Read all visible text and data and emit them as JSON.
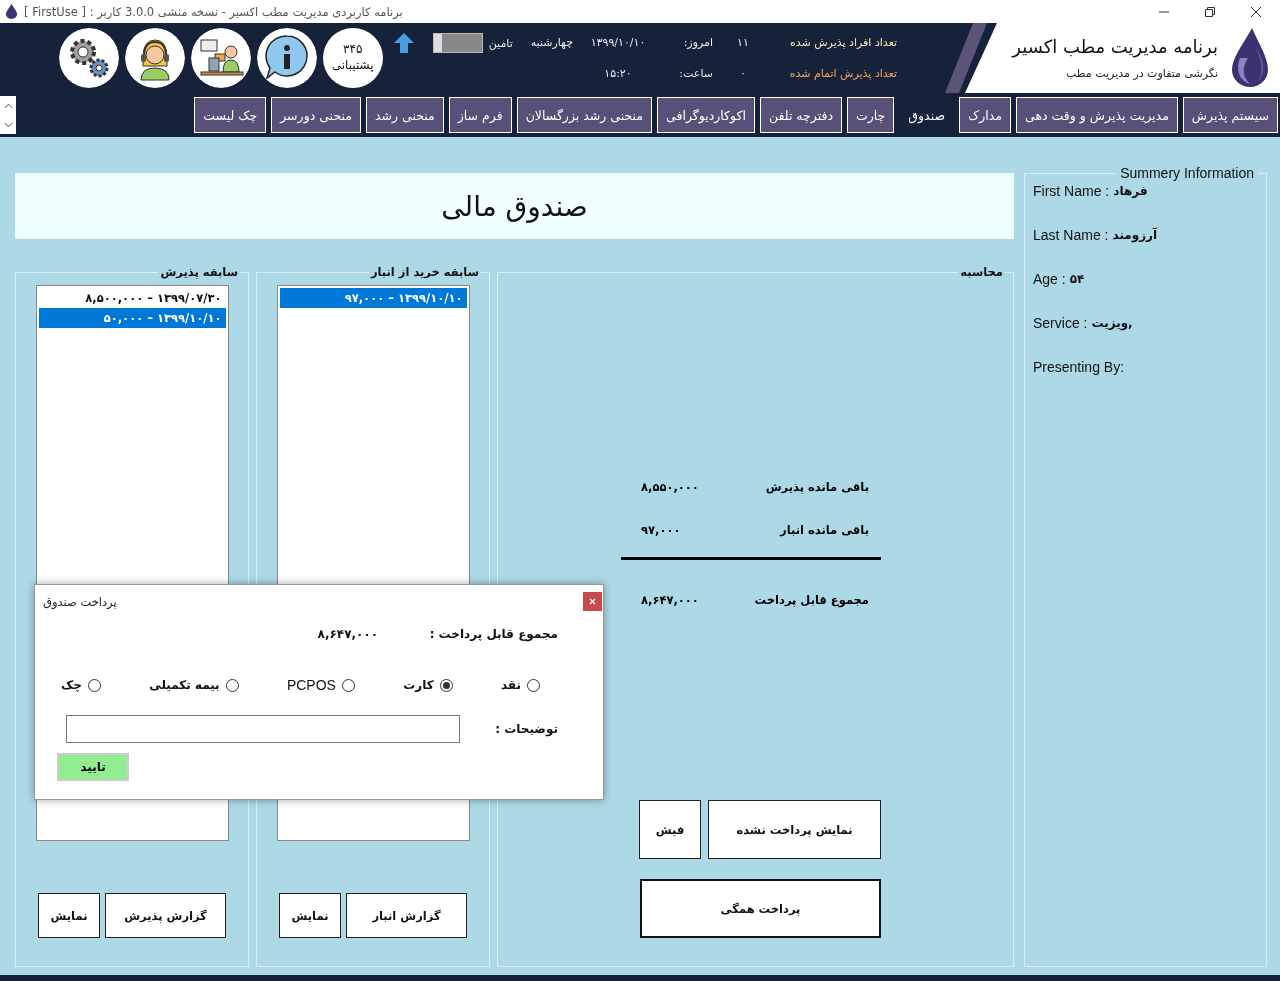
{
  "window": {
    "title": "برنامه کاربردی مدیریت مطب اکسیر - نسخه منشی 3.0.0 کاربر : [ FirstUse ]"
  },
  "header": {
    "app_title": "برنامه مدیریت مطب اکسیر",
    "tagline": "نگرشی متفاوت در مدیریت مطب",
    "stats": [
      {
        "label": "تعداد افراد پذیرش شده",
        "value": "۱۱",
        "color": "#f3e9b5"
      },
      {
        "label": "تعداد پذیرش اتمام شده",
        "value": "۰",
        "color": "#f4a460"
      }
    ],
    "date_label": "امروز:",
    "date": "۱۳۹۹/۱۰/۱۰",
    "weekday": "چهارشنبه",
    "time_label": "ساعت:",
    "time": "۱۵:۲۰",
    "toggle": {
      "label": "تامین",
      "on": false
    },
    "support": {
      "number": "۳۴۵",
      "label": "پشتیبانی"
    }
  },
  "tabs": [
    {
      "label": "سیستم پذیرش",
      "selected": false
    },
    {
      "label": "مدیریت پذیرش و وقت دهی",
      "selected": false
    },
    {
      "label": "مدارک",
      "selected": false
    },
    {
      "label": "صندوق",
      "selected": true
    },
    {
      "label": "چارت",
      "selected": false
    },
    {
      "label": "دفترچه تلفن",
      "selected": false
    },
    {
      "label": "اکوکاردیوگرافی",
      "selected": false
    },
    {
      "label": "منحنی رشد بزرگسالان",
      "selected": false
    },
    {
      "label": "فرم ساز",
      "selected": false
    },
    {
      "label": "منحنی رشد",
      "selected": false
    },
    {
      "label": "منحنی دورسر",
      "selected": false
    },
    {
      "label": "چک لیست",
      "selected": false
    }
  ],
  "page_title": "صندوق مالی",
  "summary": {
    "title": "Summery Information",
    "fields": [
      {
        "label": "First Name :",
        "value": "فرهاد"
      },
      {
        "label": "Last Name :",
        "value": "آرزومند"
      },
      {
        "label": "Age :",
        "value": "۵۴"
      },
      {
        "label": "Service :",
        "value": "ویزیت,"
      },
      {
        "label": "Presenting By:"
      }
    ]
  },
  "calculation": {
    "title": "محاسبه",
    "rows": [
      {
        "label": "باقی مانده پذیرش",
        "value": "۸,۵۵۰,۰۰۰"
      },
      {
        "label": "باقی مانده انبار",
        "value": "۹۷,۰۰۰"
      }
    ],
    "total": {
      "label": "مجموع قابل پرداخت",
      "value": "۸,۶۴۷,۰۰۰"
    },
    "buttons": [
      "نمایش پرداخت نشده",
      "فیش"
    ],
    "pay_all": "پرداخت همگی"
  },
  "warehouse_history": {
    "title": "سابقه خرید از انبار",
    "items": [
      {
        "text": "۱۳۹۹/۱۰/۱۰ – ۹۷,۰۰۰",
        "selected": true
      }
    ],
    "buttons": [
      "گزارش انبار",
      "نمایش"
    ]
  },
  "admission_history": {
    "title": "سابقه پذیرش",
    "items": [
      {
        "text": "۱۳۹۹/۰۷/۳۰ – ۸,۵۰۰,۰۰۰",
        "selected": false
      },
      {
        "text": "۱۳۹۹/۱۰/۱۰ – ۵۰,۰۰۰",
        "selected": true
      }
    ],
    "buttons": [
      "گزارش پذیرش",
      "نمایش"
    ]
  },
  "dialog": {
    "title": "پرداخت صندوق",
    "total_label": "مجموع قابل پرداخت :",
    "total": "۸,۶۴۷,۰۰۰",
    "methods": [
      {
        "label": "نقد",
        "selected": false
      },
      {
        "label": "کارت",
        "selected": true
      },
      {
        "label": "PCPOS",
        "selected": false
      },
      {
        "label": "بیمه تکمیلی",
        "selected": false
      },
      {
        "label": "چک",
        "selected": false
      }
    ],
    "notes_label": "توضیحات :",
    "confirm": "تایید"
  }
}
